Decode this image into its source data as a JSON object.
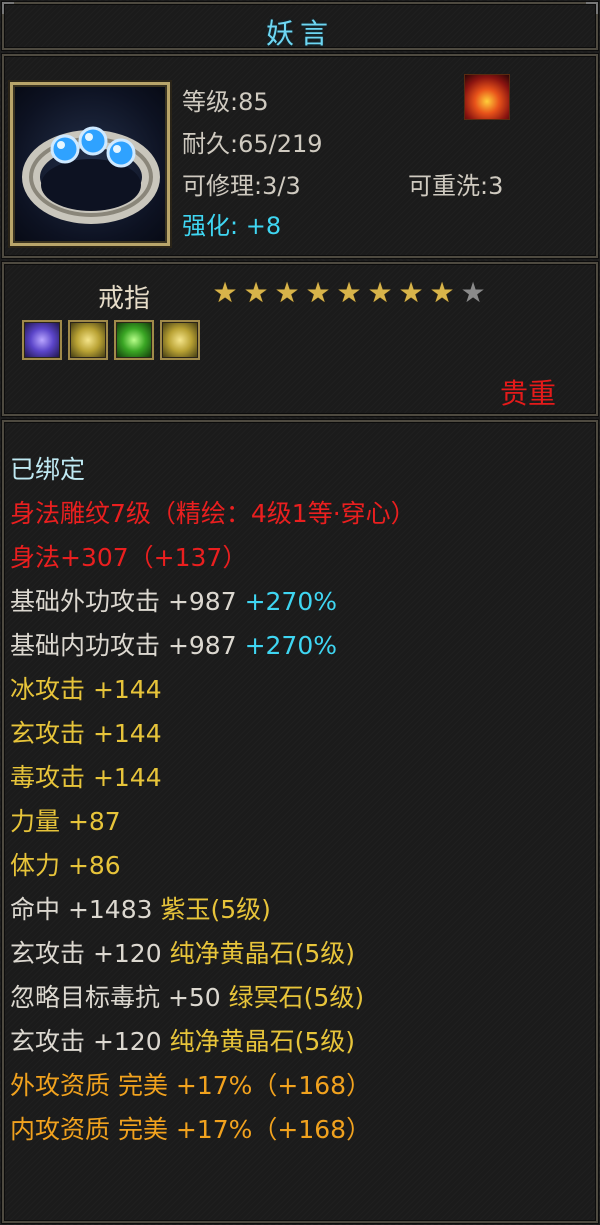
{
  "item": {
    "name": "妖言",
    "level": "等级:85",
    "durability": "耐久:65/219",
    "repairable": "可修理:3/3",
    "rewashable": "可重洗:3",
    "enhance_label": "强化:",
    "enhance_value": "+8",
    "type": "戒指",
    "stars_filled": 8,
    "stars_total": 9,
    "rarity": "贵重",
    "icon": "ring-with-blue-gems-icon",
    "set_icon": "fire-phoenix-icon",
    "gems": [
      {
        "icon": "purple-gem-icon",
        "color": "purple"
      },
      {
        "icon": "yellow-gem-icon",
        "color": "yellow"
      },
      {
        "icon": "green-gem-icon",
        "color": "green"
      },
      {
        "icon": "yellow-gem-icon",
        "color": "yellow"
      }
    ]
  },
  "stats": {
    "bound": "已绑定",
    "lines": [
      {
        "a": "身法雕纹7级（精绘：4级1等·穿心）",
        "ac": "red"
      },
      {
        "a": "身法+307（+137）",
        "ac": "red"
      },
      {
        "a": "基础外功攻击 +987",
        "ac": "w",
        "b": " +270%",
        "bc": "cyan"
      },
      {
        "a": "基础内功攻击 +987",
        "ac": "w",
        "b": " +270%",
        "bc": "cyan"
      },
      {
        "a": "冰攻击 +144",
        "ac": "yel"
      },
      {
        "a": "玄攻击 +144",
        "ac": "yel"
      },
      {
        "a": "毒攻击 +144",
        "ac": "yel"
      },
      {
        "a": "力量 +87",
        "ac": "yel"
      },
      {
        "a": "体力 +86",
        "ac": "yel"
      },
      {
        "a": "命中 +1483",
        "ac": "w",
        "b": " 紫玉(5级)",
        "bc": "yel"
      },
      {
        "a": "玄攻击 +120",
        "ac": "w",
        "b": " 纯净黄晶石(5级)",
        "bc": "yel"
      },
      {
        "a": "忽略目标毒抗 +50",
        "ac": "w",
        "b": " 绿冥石(5级)",
        "bc": "yel"
      },
      {
        "a": "玄攻击 +120",
        "ac": "w",
        "b": " 纯净黄晶石(5级)",
        "bc": "yel"
      },
      {
        "a": "外攻资质  完美 +17%（+168）",
        "ac": "orange"
      },
      {
        "a": "内攻资质  完美 +17%（+168）",
        "ac": "orange"
      }
    ]
  }
}
